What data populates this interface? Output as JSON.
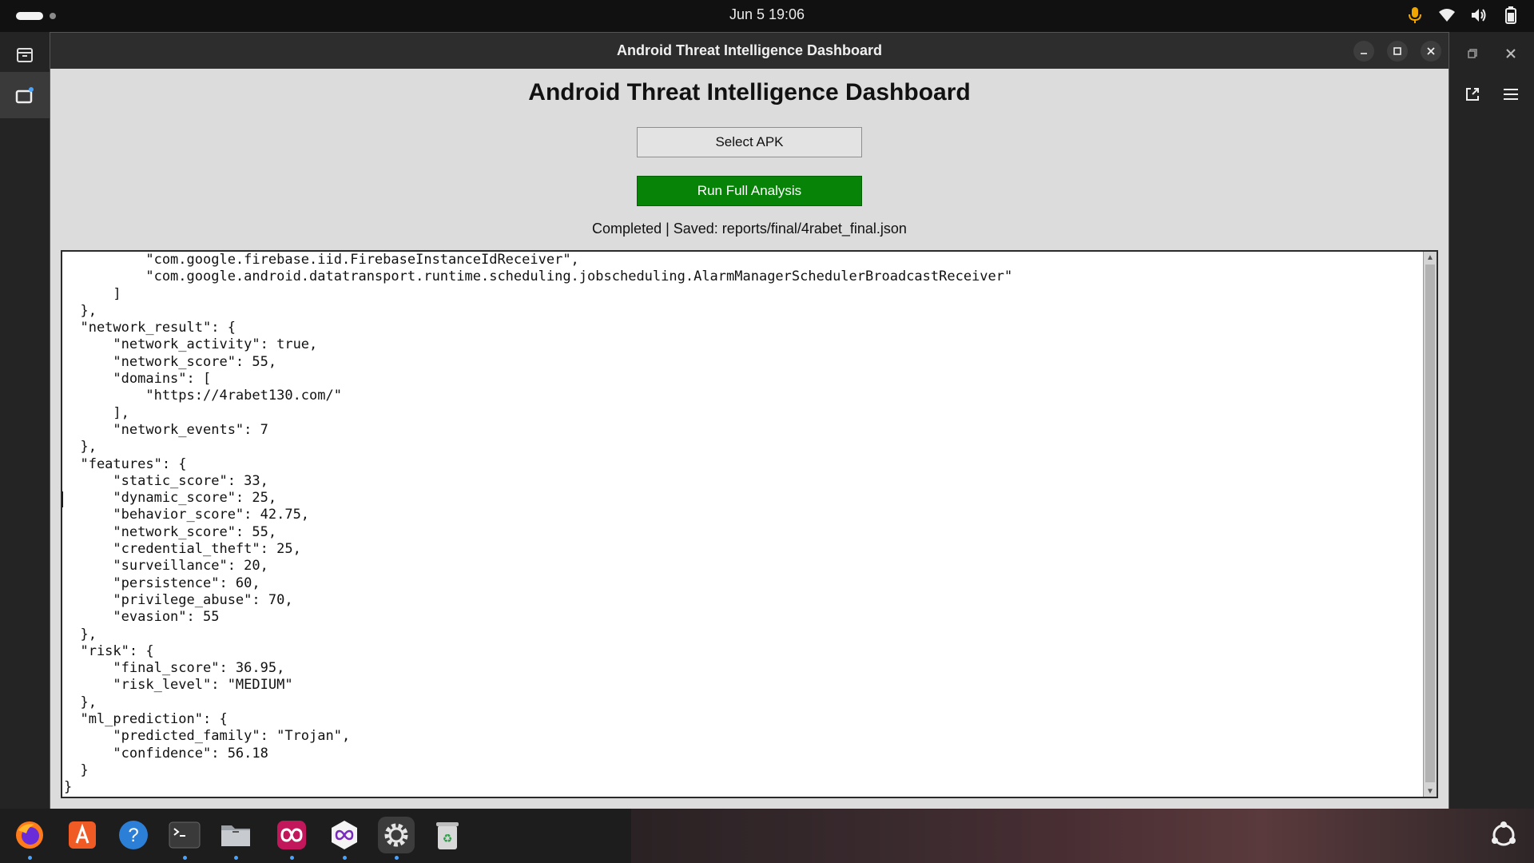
{
  "system": {
    "clock": "Jun 5  19:06"
  },
  "window": {
    "title": "Android Threat Intelligence Dashboard"
  },
  "app": {
    "heading": "Android Threat Intelligence Dashboard",
    "select_apk_label": "Select APK",
    "run_analysis_label": "Run Full Analysis",
    "status": "Completed | Saved: reports/final/4rabet_final.json",
    "output_text": "          \"com.google.firebase.iid.FirebaseInstanceIdReceiver\",\n          \"com.google.android.datatransport.runtime.scheduling.jobscheduling.AlarmManagerSchedulerBroadcastReceiver\"\n      ]\n  },\n  \"network_result\": {\n      \"network_activity\": true,\n      \"network_score\": 55,\n      \"domains\": [\n          \"https://4rabet130.com/\"\n      ],\n      \"network_events\": 7\n  },\n  \"features\": {\n      \"static_score\": 33,\n      \"dynamic_score\": 25,\n      \"behavior_score\": 42.75,\n      \"network_score\": 55,\n      \"credential_theft\": 25,\n      \"surveillance\": 20,\n      \"persistence\": 60,\n      \"privilege_abuse\": 70,\n      \"evasion\": 55\n  },\n  \"risk\": {\n      \"final_score\": 36.95,\n      \"risk_level\": \"MEDIUM\"\n  },\n  \"ml_prediction\": {\n      \"predicted_family\": \"Trojan\",\n      \"confidence\": 56.18\n  }\n}"
  },
  "colors": {
    "run_button": "#078307",
    "window_bg": "#dcdcdc",
    "titlebar": "#2d2d2d"
  },
  "taskbar": {
    "apps": [
      "firefox-icon",
      "app-center-icon",
      "help-icon",
      "terminal-icon",
      "files-icon",
      "infinity-app-icon",
      "infinity-app-alt-icon",
      "settings-icon",
      "trash-icon"
    ]
  }
}
